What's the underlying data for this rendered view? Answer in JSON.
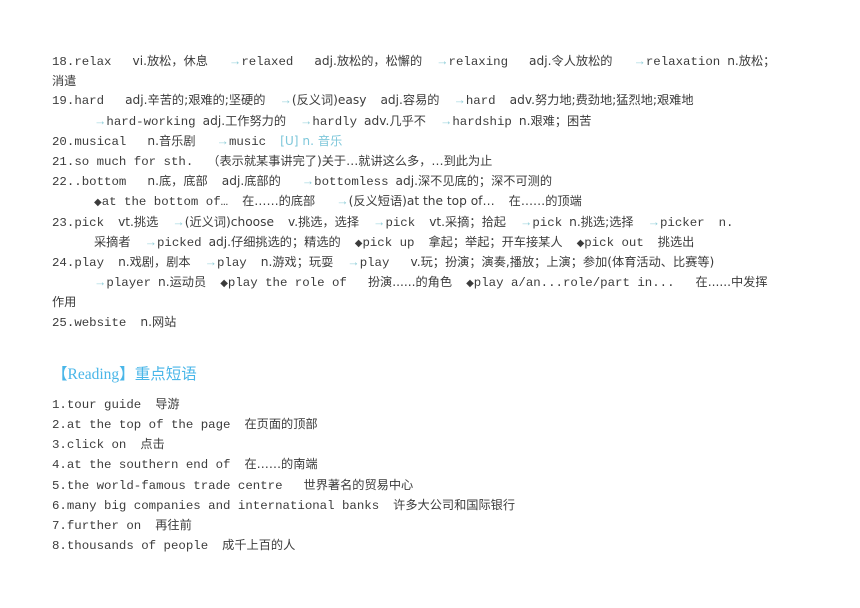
{
  "document": {
    "vocabulary_section": {
      "entries": [
        {
          "number": "18.",
          "headword": "relax",
          "line1_a": "vi.放松，休息",
          "arrow1": "→",
          "derived1": "relaxed",
          "line1_b": "adj.放松的，松懈的",
          "arrow2": "→",
          "derived2": "relaxing",
          "line1_c": "adj.令人放松的",
          "arrow3": "→",
          "derived3": "relaxation",
          "line1_d": "n.放松；",
          "line2": "消遣"
        },
        {
          "number": "19.",
          "headword": "hard",
          "line1_a": "adj.辛苦的;艰难的;坚硬的",
          "arrow1": "→",
          "derived1": "(反义词)easy",
          "line1_b": "adj.容易的",
          "arrow2": "→",
          "derived2": "hard",
          "line1_c": "adv.努力地;费劲地;猛烈地;艰难地",
          "arrow3": "→",
          "derived3": "hard-working",
          "line2_a": "adj.工作努力的",
          "arrow4": "→",
          "derived4": "hardly",
          "line2_b": "adv.几乎不",
          "arrow5": "→",
          "derived5": "hardship",
          "line2_c": "n.艰难；困苦"
        },
        {
          "number": "20.",
          "headword": "musical",
          "line1_a": "n.音乐剧",
          "arrow1": "→",
          "derived1": "music",
          "line1_b": "[U] n. 音乐"
        },
        {
          "number": "21.",
          "headword": "so much for sth.",
          "line1_a": "（表示就某事讲完了)关于…就讲这么多，…到此为止"
        },
        {
          "number": "22..",
          "headword": "bottom",
          "line1_a": "n.底，底部",
          "line1_b": "adj.底部的",
          "arrow1": "→",
          "derived1": "bottomless",
          "line1_c": "adj.深不见底的；深不可测的",
          "diamond": "◆",
          "phrase1": "at the bottom of…",
          "line2_a": "在……的底部",
          "arrow2": "→",
          "derived2": "(反义短语)at the top of…",
          "line2_b": "在……的顶端"
        },
        {
          "number": "23.",
          "headword": "pick",
          "line1_a": "vt.挑选",
          "arrow1": "→",
          "derived1": "(近义词)choose",
          "line1_b": "v.挑选，选择",
          "arrow2": "→",
          "derived2": "pick",
          "line1_c": "vt.采摘；拾起",
          "arrow3": "→",
          "derived3": "pick",
          "line1_d": "n.挑选;选择",
          "arrow4": "→",
          "derived4": "picker",
          "line1_e": "n.",
          "line2_a": "采摘者",
          "arrow5": "→",
          "derived5": "picked",
          "line2_b": "adj.仔细挑选的；精选的",
          "diamond1": "◆",
          "phrase1": "pick up",
          "line2_c": "拿起；举起；开车接某人",
          "diamond2": "◆",
          "phrase2": "pick out",
          "line2_d": "挑选出"
        },
        {
          "number": "24.",
          "headword": "play",
          "line1_a": "n.戏剧，剧本",
          "arrow1": "→",
          "derived1": "play",
          "line1_b": "n.游戏；玩耍",
          "arrow2": "→",
          "derived2": "play",
          "line1_c": "v.玩；扮演；演奏,播放；上演；参加(体育活动、比赛等)",
          "arrow3": "→",
          "derived3": "player",
          "line2_a": "n.运动员",
          "diamond1": "◆",
          "phrase1": "play the role of",
          "line2_b": "扮演......的角色",
          "diamond2": "◆",
          "phrase2": "play a/an...role/part in...",
          "line2_c": "在......中发挥",
          "line3": "作用"
        },
        {
          "number": "25.",
          "headword": "website",
          "line1_a": "n.网站"
        }
      ]
    },
    "reading_section": {
      "header_bracket_open": "【",
      "header_en": "Reading",
      "header_bracket_close": "】",
      "header_cn": "重点短语",
      "items": [
        {
          "number": "1.",
          "english": "tour guide",
          "chinese": "导游"
        },
        {
          "number": "2.",
          "english": "at the top of the page",
          "chinese": "在页面的顶部"
        },
        {
          "number": "3.",
          "english": "click on",
          "chinese": "点击"
        },
        {
          "number": "4.",
          "english": "at the southern end of",
          "chinese": "在……的南端"
        },
        {
          "number": "5.",
          "english": "the world-famous trade centre",
          "chinese": "世界著名的贸易中心"
        },
        {
          "number": "6.",
          "english": "many big companies and international banks",
          "chinese": "许多大公司和国际银行"
        },
        {
          "number": "7.",
          "english": "further on",
          "chinese": "再往前"
        },
        {
          "number": "8.",
          "english": "thousands of people",
          "chinese": "成千上百的人"
        }
      ]
    },
    "colors": {
      "accent_header": "#49b6e8",
      "arrow_teal": "#8fcdd8",
      "body_text": "#3c3c3c"
    }
  }
}
